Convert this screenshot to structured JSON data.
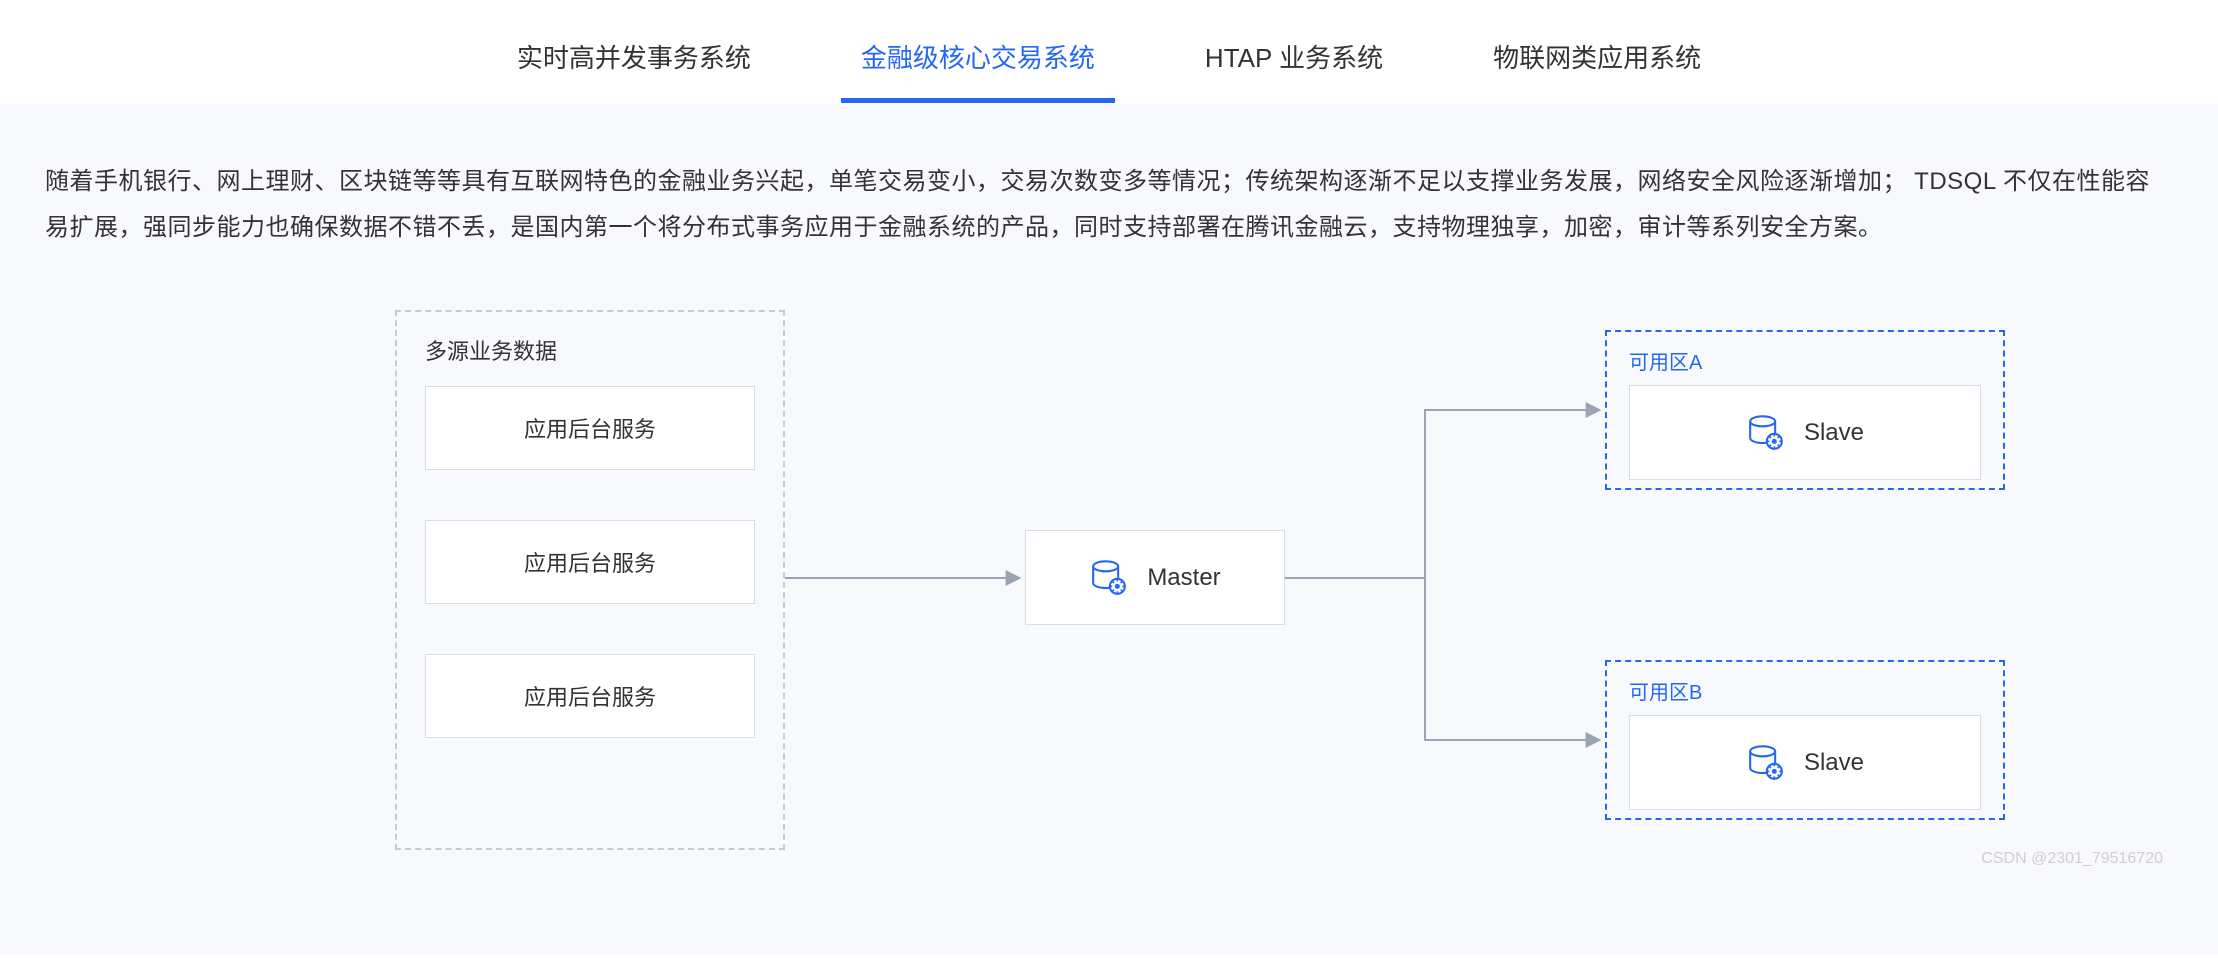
{
  "tabs": [
    {
      "label": "实时高并发事务系统",
      "active": false
    },
    {
      "label": "金融级核心交易系统",
      "active": true
    },
    {
      "label": "HTAP 业务系统",
      "active": false
    },
    {
      "label": "物联网类应用系统",
      "active": false
    }
  ],
  "description": "随着手机银行、网上理财、区块链等等具有互联网特色的金融业务兴起，单笔交易变小，交易次数变多等情况；传统架构逐渐不足以支撑业务发展，网络安全风险逐渐增加； TDSQL 不仅在性能容易扩展，强同步能力也确保数据不错不丢，是国内第一个将分布式事务应用于金融系统的产品，同时支持部署在腾讯金融云，支持物理独享，加密，审计等系列安全方案。",
  "diagram": {
    "source_group_title": "多源业务数据",
    "app_service_label": "应用后台服务",
    "master_label": "Master",
    "zone_a_title": "可用区A",
    "zone_b_title": "可用区B",
    "slave_label": "Slave"
  },
  "watermark": "CSDN @2301_79516720"
}
